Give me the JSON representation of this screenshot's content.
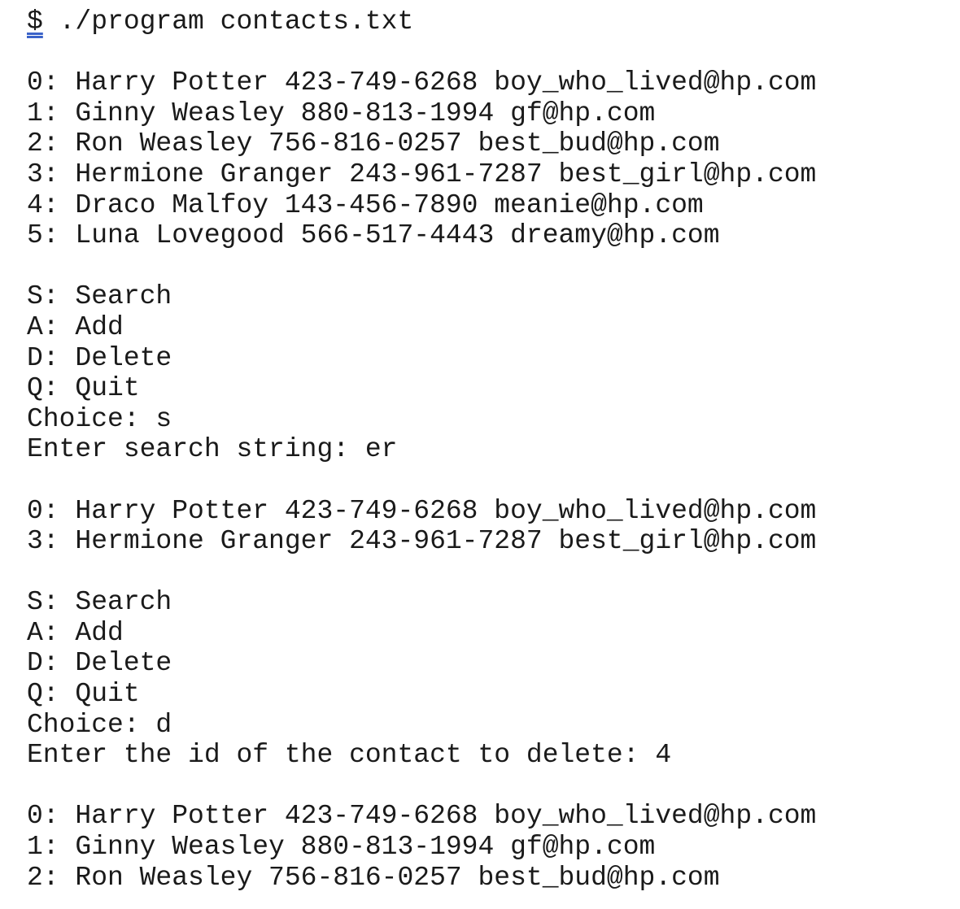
{
  "command": {
    "prompt_symbol": "$",
    "text": " ./program contacts.txt"
  },
  "initial_list": [
    "0: Harry Potter 423-749-6268 boy_who_lived@hp.com",
    "1: Ginny Weasley 880-813-1994 gf@hp.com",
    "2: Ron Weasley 756-816-0257 best_bud@hp.com",
    "3: Hermione Granger 243-961-7287 best_girl@hp.com",
    "4: Draco Malfoy 143-456-7890 meanie@hp.com",
    "5: Luna Lovegood 566-517-4443 dreamy@hp.com"
  ],
  "menu_1": {
    "search": "S: Search",
    "add": "A: Add",
    "delete": "D: Delete",
    "quit": "Q: Quit",
    "choice": "Choice: s",
    "prompt": "Enter search string: er"
  },
  "search_results": [
    "0: Harry Potter 423-749-6268 boy_who_lived@hp.com",
    "3: Hermione Granger 243-961-7287 best_girl@hp.com"
  ],
  "menu_2": {
    "search": "S: Search",
    "add": "A: Add",
    "delete": "D: Delete",
    "quit": "Q: Quit",
    "choice": "Choice: d",
    "prompt": "Enter the id of the contact to delete: 4"
  },
  "final_list": [
    "0: Harry Potter 423-749-6268 boy_who_lived@hp.com",
    "1: Ginny Weasley 880-813-1994 gf@hp.com",
    "2: Ron Weasley 756-816-0257 best_bud@hp.com"
  ]
}
